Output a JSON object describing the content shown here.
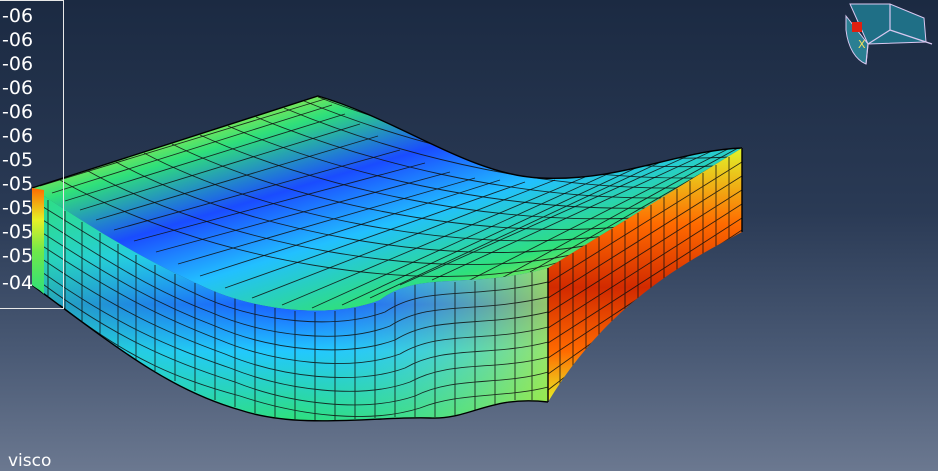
{
  "legend": {
    "labels": [
      "-06",
      "-06",
      "-06",
      "-06",
      "-06",
      "-06",
      "-05",
      "-05",
      "-05",
      "-05",
      "-05",
      "-04"
    ]
  },
  "step_label": "visco",
  "triad": {
    "axis_label": "X"
  },
  "contour_colors": {
    "low": "#1a3cff",
    "low_mid": "#1ec8ff",
    "mid": "#22e07a",
    "high_mid": "#d6f52a",
    "high": "#ff6a00",
    "max": "#d22a00"
  }
}
